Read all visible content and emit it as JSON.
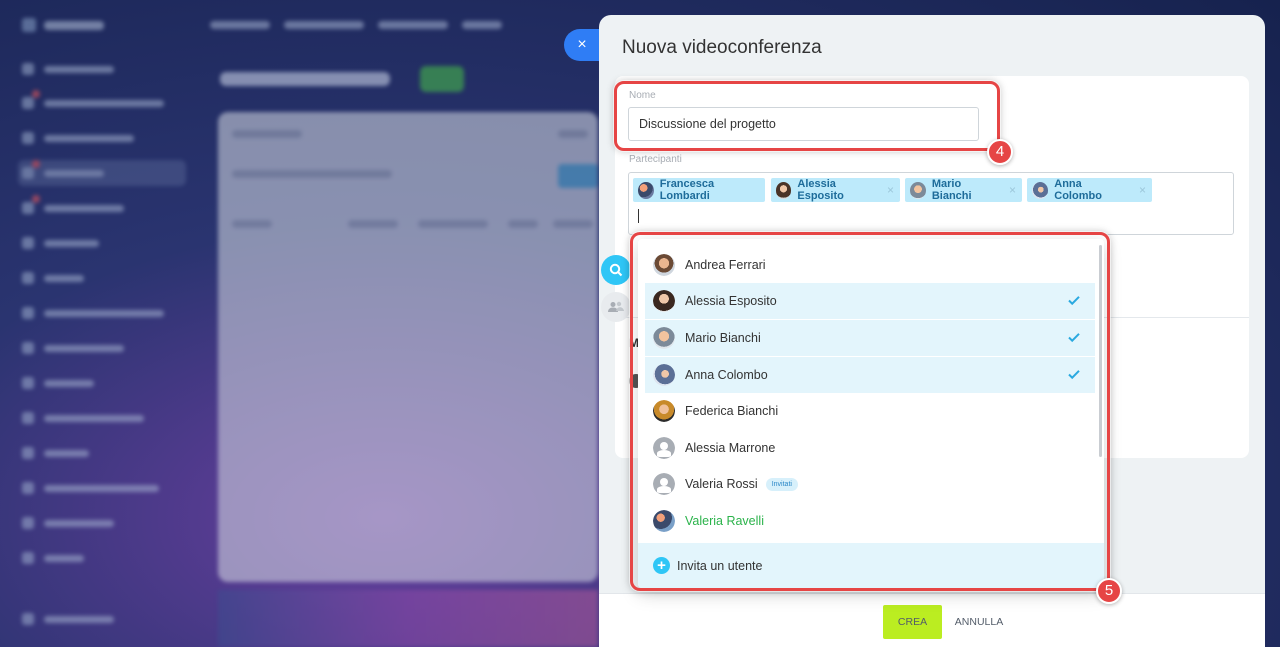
{
  "panel": {
    "title": "Nuova videoconferenza",
    "name_label": "Nome",
    "name_value": "Discussione del progetto",
    "participants_label": "Partecipanti",
    "chips": [
      {
        "name": "Francesca Lombardi",
        "removable": false
      },
      {
        "name": "Alessia Esposito",
        "removable": true
      },
      {
        "name": "Mario Bianchi",
        "removable": true
      },
      {
        "name": "Anna Colombo",
        "removable": true
      }
    ],
    "chip_remove_glyph": "×",
    "background_letter": "M",
    "close_glyph": "×"
  },
  "dropdown": {
    "items": [
      {
        "name": "Andrea Ferrari",
        "selected": false
      },
      {
        "name": "Alessia Esposito",
        "selected": true
      },
      {
        "name": "Mario Bianchi",
        "selected": true
      },
      {
        "name": "Anna Colombo",
        "selected": true
      },
      {
        "name": "Federica Bianchi",
        "selected": false
      },
      {
        "name": "Alessia Marrone",
        "selected": false
      },
      {
        "name": "Valeria Rossi",
        "selected": false,
        "badge": "Invitati"
      },
      {
        "name": "Valeria Ravelli",
        "selected": false
      }
    ],
    "invite_label": "Invita un utente",
    "plus_glyph": "+"
  },
  "footer": {
    "create_label": "CREA",
    "cancel_label": "ANNULLA"
  },
  "annotations": {
    "name_step": "4",
    "dropdown_step": "5"
  },
  "colors": {
    "accent_blue": "#2f7df5",
    "create_green": "#bbed21",
    "chip_bg": "#bdeafb",
    "selected_row": "#e3f5fc",
    "check_blue": "#2aa9e0",
    "annotation_red": "#e64545",
    "guest_green": "#2bb34b"
  }
}
